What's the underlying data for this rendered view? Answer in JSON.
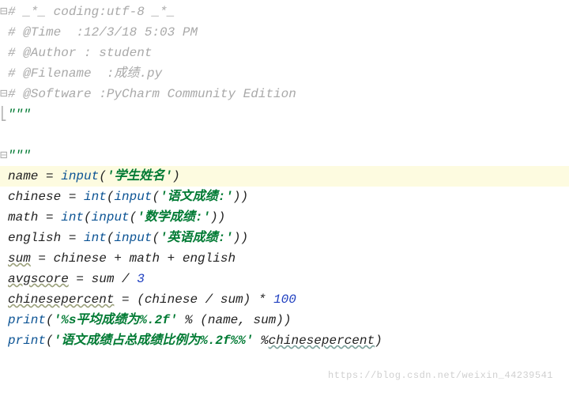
{
  "code": {
    "l1_comment": "# _*_ coding:utf-8 _*_",
    "l2_comment": "# @Time  :12/3/18 5:03 PM",
    "l3_comment": "# @Author : student",
    "l4_comment": "# @Filename  :成绩.py",
    "l5_comment": "# @Software :PyCharm Community Edition",
    "l6_docq": "\"\"\"",
    "l7_blank": "",
    "l8_docq": "\"\"\"",
    "l9": {
      "lhs": "name = ",
      "fn": "input",
      "open": "(",
      "str": "'学生姓名'",
      "close": ")"
    },
    "l10": {
      "lhs": "chinese = ",
      "fn1": "int",
      "open1": "(",
      "fn2": "input",
      "open2": "(",
      "str": "'语文成绩:'",
      "close": "))"
    },
    "l11": {
      "lhs": "math = ",
      "fn1": "int",
      "open1": "(",
      "fn2": "input",
      "open2": "(",
      "str": "'数学成绩:'",
      "close": "))"
    },
    "l12": {
      "lhs": "english = ",
      "fn1": "int",
      "open1": "(",
      "fn2": "input",
      "open2": "(",
      "str": "'英语成绩:'",
      "close": "))"
    },
    "l13": {
      "lhs_var": "sum",
      "rest": " = chinese + math + english"
    },
    "l14": {
      "lhs_var": "avgscore",
      "mid": " = sum / ",
      "num": "3"
    },
    "l15": {
      "lhs_var": "chinesepercent",
      "mid": " = (chinese / sum) * ",
      "num": "100"
    },
    "l16": {
      "fn": "print",
      "open": "(",
      "str": "'%s平均成绩为%.2f'",
      "mid": " % (name, sum))"
    },
    "l17": {
      "fn": "print",
      "open": "(",
      "str": "'语文成绩占总成绩比例为%.2f%%'",
      "mid": " %",
      "var": "chinesepercent",
      "close": ")"
    }
  },
  "gutter": {
    "fold_open": "⊟",
    "fold_close": "⊟",
    "branch": "⎣"
  },
  "watermark": "https://blog.csdn.net/weixin_44239541"
}
